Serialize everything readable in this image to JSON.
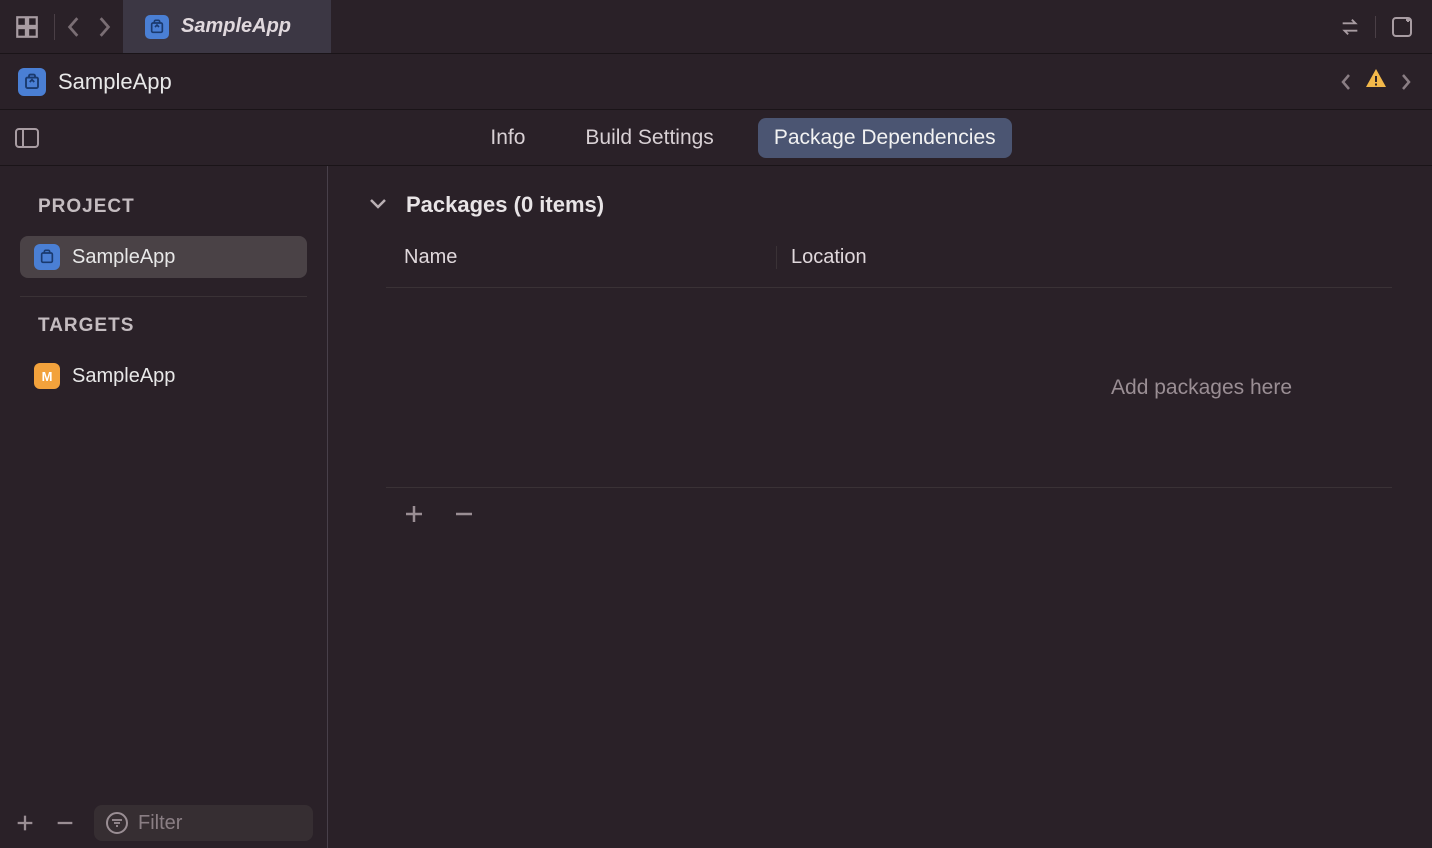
{
  "toolbar": {
    "tab_title": "SampleApp"
  },
  "breadcrumb": {
    "title": "SampleApp"
  },
  "editor_tabs": {
    "info": "Info",
    "build_settings": "Build Settings",
    "package_dependencies": "Package Dependencies",
    "active": "package_dependencies"
  },
  "sidebar": {
    "project_header": "PROJECT",
    "project_item": "SampleApp",
    "targets_header": "TARGETS",
    "target_item": "SampleApp",
    "target_icon_letter": "M",
    "filter_placeholder": "Filter"
  },
  "content": {
    "packages_header": "Packages (0 items)",
    "col_name": "Name",
    "col_location": "Location",
    "empty_text": "Add packages here"
  }
}
